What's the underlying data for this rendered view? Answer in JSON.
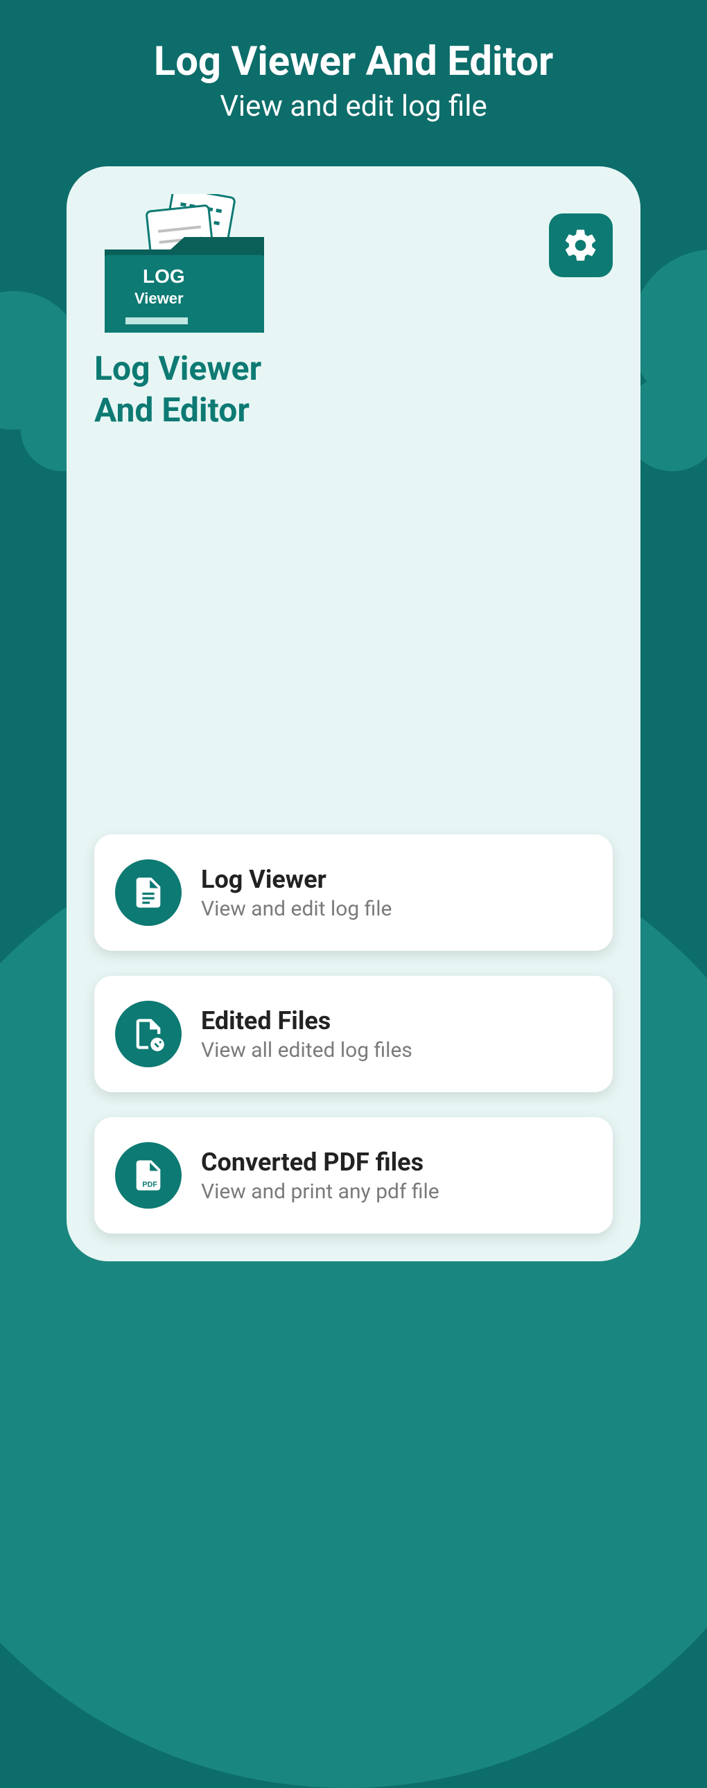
{
  "header": {
    "title": "Log Viewer And Editor",
    "subtitle": "View and edit log file"
  },
  "app": {
    "logo_label_top": "LOG",
    "logo_label_bottom": "Viewer",
    "name_line1": "Log Viewer",
    "name_line2": "And Editor"
  },
  "menu": [
    {
      "icon": "log-file-icon",
      "title": "Log Viewer",
      "subtitle": "View and edit log file"
    },
    {
      "icon": "edited-file-icon",
      "title": "Edited Files",
      "subtitle": "View all edited log files"
    },
    {
      "icon": "pdf-file-icon",
      "title": "Converted PDF files",
      "subtitle": "View and print any pdf file"
    }
  ],
  "colors": {
    "brand": "#0d7a73",
    "brand_dark": "#0d6d6a",
    "brand_light": "#1a8680",
    "card_bg": "#ffffff",
    "phone_bg": "#e7f6f4"
  }
}
